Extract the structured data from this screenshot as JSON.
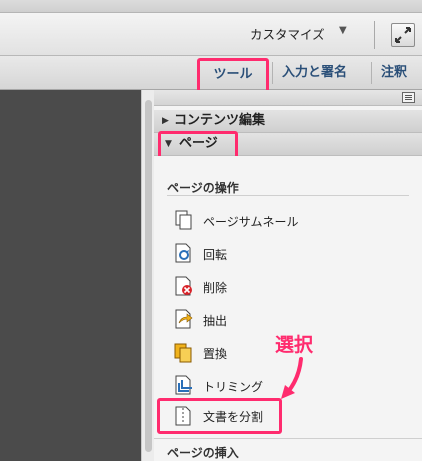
{
  "customize_bar": {
    "label": "カスタマイズ",
    "chevron": "▼",
    "expand_icon": "expand-icon"
  },
  "tabs": [
    {
      "label": "ツール",
      "highlighted": true
    },
    {
      "label": "入力と署名"
    },
    {
      "label": "注釈"
    }
  ],
  "panel": {
    "content_edit_header": "コンテンツ編集",
    "pages_header": "ページ",
    "page_ops_title": "ページの操作",
    "items": [
      {
        "label": "ページサムネール",
        "icon": "page-thumbnails-icon"
      },
      {
        "label": "回転",
        "icon": "rotate-icon"
      },
      {
        "label": "削除",
        "icon": "delete-page-icon"
      },
      {
        "label": "抽出",
        "icon": "extract-icon"
      },
      {
        "label": "置換",
        "icon": "replace-icon"
      },
      {
        "label": "トリミング",
        "icon": "crop-icon"
      },
      {
        "label": "文書を分割",
        "icon": "split-document-icon",
        "highlighted": true
      }
    ],
    "insert_title": "ページの挿入"
  },
  "annotation": {
    "text": "選択"
  },
  "colors": {
    "highlight": "#ff2b6e",
    "tab_text": "#2a4f78"
  }
}
